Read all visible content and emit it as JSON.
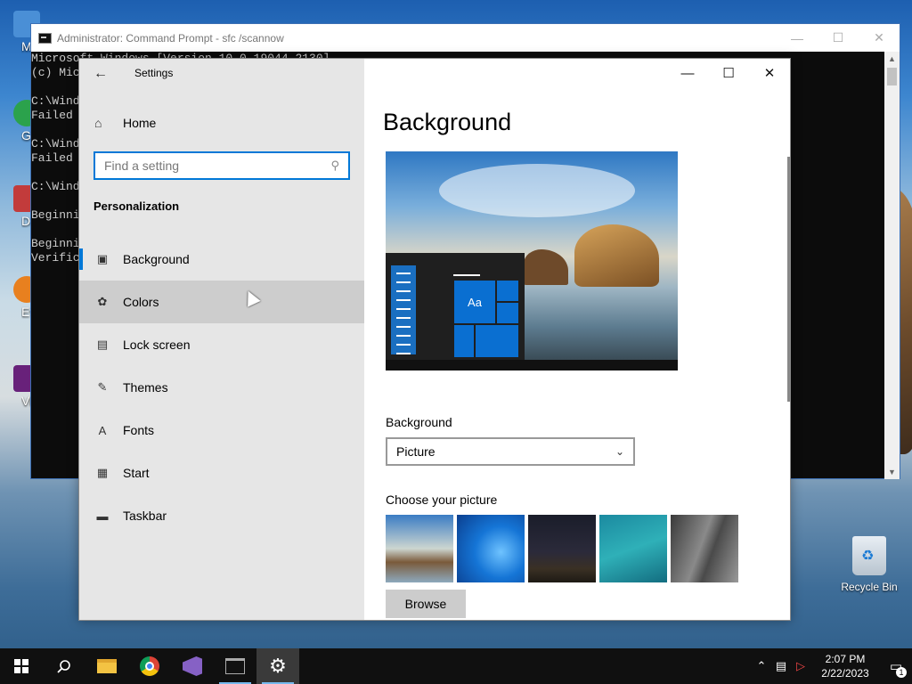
{
  "desktop": {
    "icons": [
      {
        "label": "My Co",
        "icon": "computer-icon",
        "color": "#4a8fd6"
      },
      {
        "label": "Go Ch",
        "icon": "chrome-icon",
        "color": "#2ba24c"
      },
      {
        "label": "DataV",
        "icon": "datav-icon",
        "color": "#c23b3b"
      },
      {
        "label": "Ever",
        "icon": "everything-icon",
        "color": "#e8801f"
      },
      {
        "label": "Visua",
        "icon": "visual-studio-icon",
        "color": "#68217a"
      }
    ],
    "recycle_bin": "Recycle Bin"
  },
  "cmd": {
    "title": "Administrator: Command Prompt - sfc  /scannow",
    "lines": [
      "Microsoft Windows [Version 10.0.19044.2130]",
      "(c) Mic",
      "",
      "C:\\Wind",
      "Failed",
      "",
      "C:\\Wind",
      "Failed",
      "",
      "C:\\Wind",
      "",
      "Beginni",
      "",
      "Beginni",
      "Verific"
    ]
  },
  "settings": {
    "app_title": "Settings",
    "home": "Home",
    "search_placeholder": "Find a setting",
    "section": "Personalization",
    "nav": [
      {
        "label": "Background",
        "icon": "picture-icon"
      },
      {
        "label": "Colors",
        "icon": "palette-icon"
      },
      {
        "label": "Lock screen",
        "icon": "lock-screen-icon"
      },
      {
        "label": "Themes",
        "icon": "themes-icon"
      },
      {
        "label": "Fonts",
        "icon": "fonts-icon"
      },
      {
        "label": "Start",
        "icon": "start-icon"
      },
      {
        "label": "Taskbar",
        "icon": "taskbar-icon"
      }
    ],
    "page_title": "Background",
    "preview_sample": "Aa",
    "background_label": "Background",
    "background_value": "Picture",
    "choose_label": "Choose your picture",
    "browse": "Browse",
    "accent_color": "#0078d7"
  },
  "taskbar": {
    "time": "2:07 PM",
    "date": "2/22/2023",
    "notification_count": "1"
  }
}
